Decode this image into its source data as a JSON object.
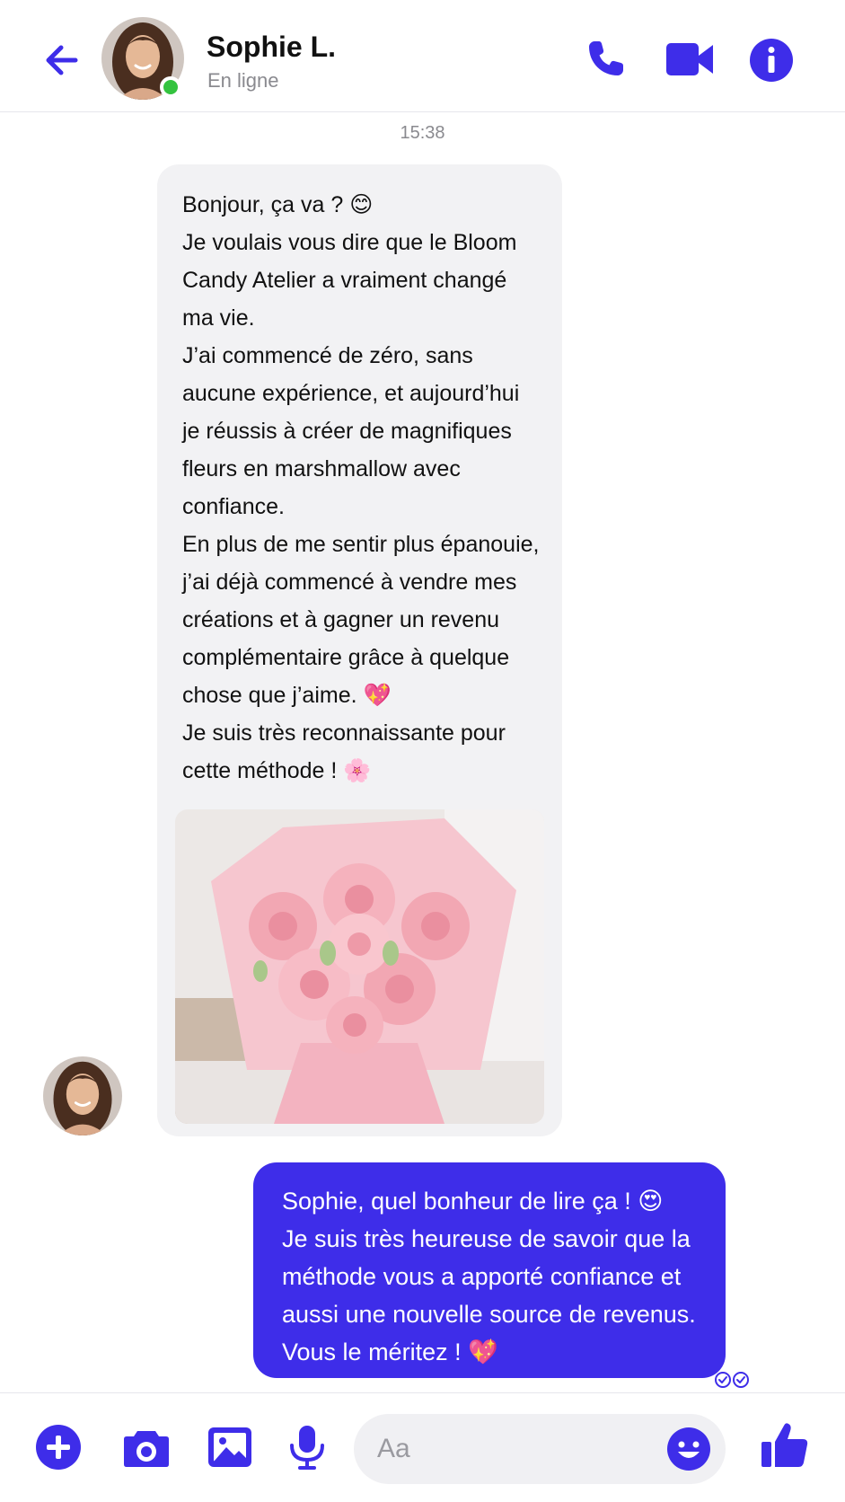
{
  "colors": {
    "accent": "#3e2de9",
    "online": "#34c33f",
    "incoming_bubble": "#f2f2f4",
    "muted_text": "#8a8a8f"
  },
  "header": {
    "contact_name": "Sophie L.",
    "status": "En ligne",
    "icons": [
      "back-arrow-icon",
      "phone-icon",
      "video-camera-icon",
      "info-icon"
    ]
  },
  "conversation": {
    "timestamp": "15:38",
    "incoming": {
      "text": "Bonjour, ça va ? 😊\nJe voulais vous dire que le Bloom Candy Atelier a vraiment changé ma vie.\nJ’ai commencé de zéro, sans aucune expérience, et aujourd’hui je réussis à créer de magnifiques fleurs en marshmallow avec confiance.\nEn plus de me sentir plus épanouie, j’ai déjà commencé à vendre mes créations et à gagner un revenu complémentaire grâce à quelque chose que j’aime. 💖\nJe suis très reconnaissante pour cette méthode ! 🌸",
      "attachment": "photo of a pink marshmallow flower bouquet"
    },
    "outgoing": {
      "text": "Sophie, quel bonheur de lire ça ! 😍\nJe suis très heureuse de savoir que la méthode vous a apporté confiance et aussi une nouvelle source de revenus.\nVous le méritez ! 💖",
      "status_icon": "double-check-icon"
    }
  },
  "footer": {
    "placeholder": "Aa",
    "icons": [
      "plus-icon",
      "camera-icon",
      "image-icon",
      "microphone-icon",
      "emoji-icon",
      "thumbs-up-icon"
    ]
  }
}
